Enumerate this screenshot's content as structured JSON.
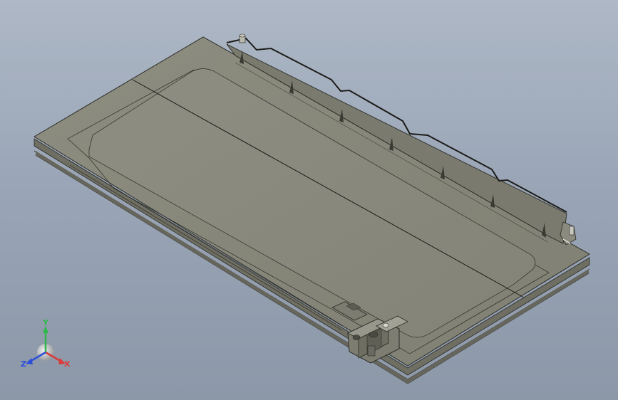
{
  "viewport": {
    "background_top": "#aeb8c6",
    "background_bottom": "#8c98a8"
  },
  "model": {
    "color_face": "#87877a",
    "color_face_light": "#8f8f82",
    "color_edge": "#2b2b26"
  },
  "triad": {
    "y_label": "Y",
    "x_label": "X",
    "z_label": "Z",
    "y_color": "#2fb84a",
    "x_color": "#d93a3a",
    "z_color": "#2b4fd9"
  }
}
